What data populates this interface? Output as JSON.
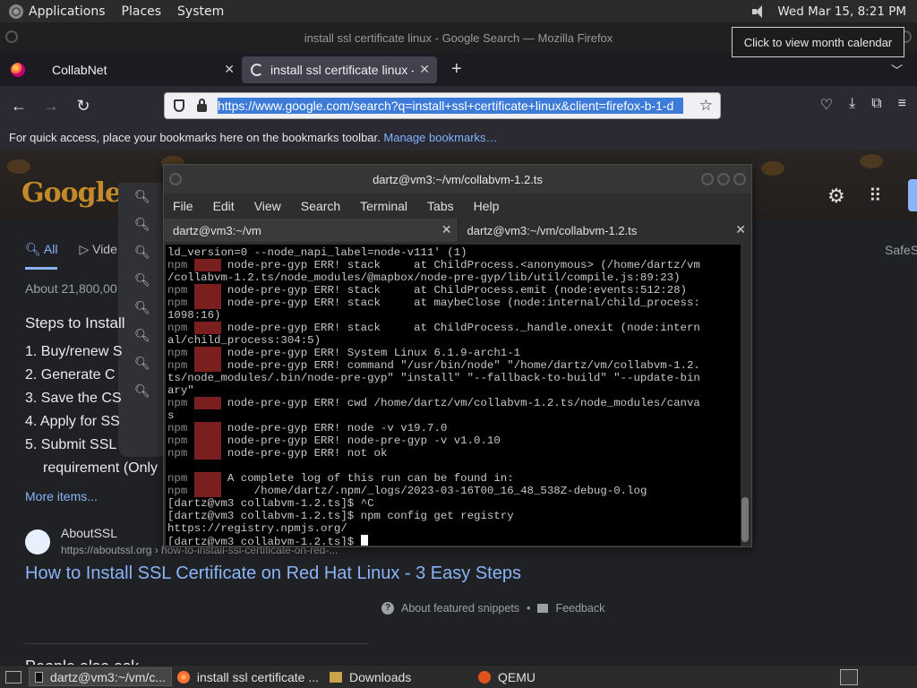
{
  "top_panel": {
    "menus": [
      "Applications",
      "Places",
      "System"
    ],
    "datetime": "Wed Mar 15,  8:21 PM"
  },
  "tooltip": "Click to view month calendar",
  "firefox": {
    "window_title": "install ssl certificate linux - Google Search — Mozilla Firefox",
    "tabs": [
      {
        "label": "CollabNet"
      },
      {
        "label": "install ssl certificate linux - G"
      }
    ],
    "url": "https://www.google.com/search?q=install+ssl+certificate+linux&client=firefox-b-1-d",
    "bookmarks_prompt": "For quick access, place your bookmarks here on the bookmarks toolbar.",
    "manage_bookmarks": "Manage bookmarks…"
  },
  "google": {
    "logo_text": "Google",
    "tabs": [
      "All",
      "Vide"
    ],
    "safesearch": "SafeS",
    "results_count": "About 21,800,00",
    "steps_title": "Steps to Install",
    "steps": [
      "1. Buy/renew S",
      "2. Generate C",
      "3. Save the CS",
      "4. Apply for SS",
      "5. Submit SSL",
      "requirement (Only"
    ],
    "more_items": "More items...",
    "site_name": "AboutSSL",
    "site_url": "https://aboutssl.org › how-to-install-ssl-certificate-on-red-...",
    "result_title": "How to Install SSL Certificate on Red Hat Linux - 3 Easy Steps",
    "about_snippets": "About featured snippets",
    "feedback": "Feedback",
    "bottom_heading": "People also ask"
  },
  "terminal": {
    "title": "dartz@vm3:~/vm/collabvm-1.2.ts",
    "menu": [
      "File",
      "Edit",
      "View",
      "Search",
      "Terminal",
      "Tabs",
      "Help"
    ],
    "tabs": [
      {
        "label": "dartz@vm3:~/vm"
      },
      {
        "label": "dartz@vm3:~/vm/collabvm-1.2.ts"
      }
    ],
    "lines": [
      {
        "text": "ld_version=0 --node_napi_label=node-v111' (1)"
      },
      {
        "prefix": "npm",
        "err": "ERR!",
        "text": " node-pre-gyp ERR! stack     at ChildProcess.<anonymous> (/home/dartz/vm"
      },
      {
        "text": "/collabvm-1.2.ts/node_modules/@mapbox/node-pre-gyp/lib/util/compile.js:89:23)"
      },
      {
        "prefix": "npm",
        "err": "ERR!",
        "text": " node-pre-gyp ERR! stack     at ChildProcess.emit (node:events:512:28)"
      },
      {
        "prefix": "npm",
        "err": "ERR!",
        "text": " node-pre-gyp ERR! stack     at maybeClose (node:internal/child_process:"
      },
      {
        "text": "1098:16)"
      },
      {
        "prefix": "npm",
        "err": "ERR!",
        "text": " node-pre-gyp ERR! stack     at ChildProcess._handle.onexit (node:intern"
      },
      {
        "text": "al/child_process:304:5)"
      },
      {
        "prefix": "npm",
        "err": "ERR!",
        "text": " node-pre-gyp ERR! System Linux 6.1.9-arch1-1"
      },
      {
        "prefix": "npm",
        "err": "ERR!",
        "text": " node-pre-gyp ERR! command \"/usr/bin/node\" \"/home/dartz/vm/collabvm-1.2."
      },
      {
        "text": "ts/node_modules/.bin/node-pre-gyp\" \"install\" \"--fallback-to-build\" \"--update-bin"
      },
      {
        "text": "ary\""
      },
      {
        "prefix": "npm",
        "err": "ERR!",
        "text": " node-pre-gyp ERR! cwd /home/dartz/vm/collabvm-1.2.ts/node_modules/canva"
      },
      {
        "text": "s"
      },
      {
        "prefix": "npm",
        "err": "ERR!",
        "text": " node-pre-gyp ERR! node -v v19.7.0"
      },
      {
        "prefix": "npm",
        "err": "ERR!",
        "text": " node-pre-gyp ERR! node-pre-gyp -v v1.0.10"
      },
      {
        "prefix": "npm",
        "err": "ERR!",
        "text": " node-pre-gyp ERR! not ok"
      },
      {
        "text": ""
      },
      {
        "prefix": "npm",
        "err": "ERR!",
        "text": " A complete log of this run can be found in:"
      },
      {
        "prefix": "npm",
        "err": "ERR!",
        "text": "     /home/dartz/.npm/_logs/2023-03-16T00_16_48_538Z-debug-0.log"
      },
      {
        "text": "[dartz@vm3 collabvm-1.2.ts]$ ^C"
      },
      {
        "text": "[dartz@vm3 collabvm-1.2.ts]$ npm config get registry"
      },
      {
        "text": "https://registry.npmjs.org/"
      },
      {
        "text": "[dartz@vm3 collabvm-1.2.ts]$ ",
        "cursor": true
      }
    ]
  },
  "taskbar": {
    "items": [
      {
        "label": "dartz@vm3:~/vm/c...",
        "icon": "terminal-icon"
      },
      {
        "label": "install ssl certificate ...",
        "icon": "firefox-icon"
      },
      {
        "label": "Downloads",
        "icon": "folder-icon"
      },
      {
        "label": "QEMU",
        "icon": "qemu-icon"
      }
    ]
  },
  "colors": {
    "link": "#8ab4f8",
    "terminal_bg": "#000000",
    "npm_err_bg": "#7a1f1f",
    "url_selection": "#3d7bd9"
  }
}
